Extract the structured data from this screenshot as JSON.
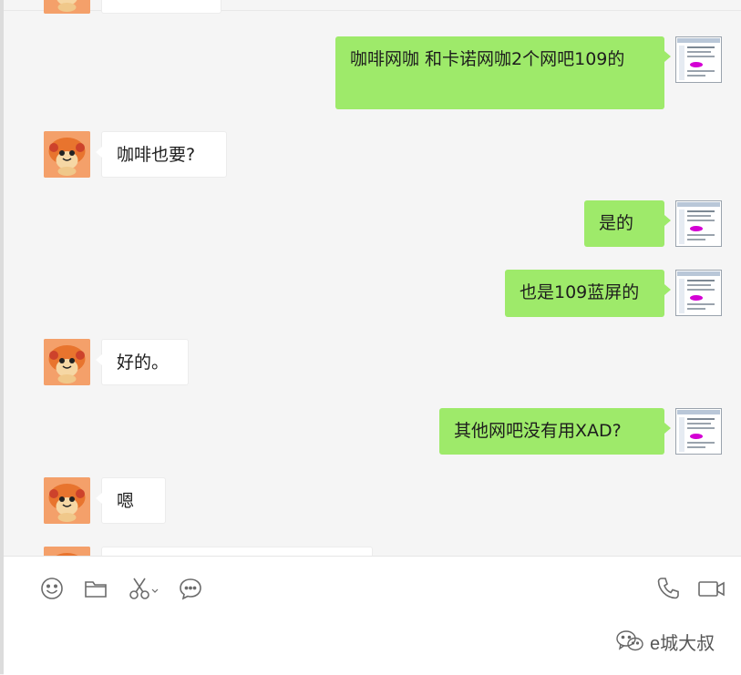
{
  "messages": [
    {
      "from": "me",
      "text": "咖啡网咖 和卡诺网咖2个网吧109的"
    },
    {
      "from": "friend",
      "text": "咖啡也要?"
    },
    {
      "from": "me",
      "text": "是的"
    },
    {
      "from": "me",
      "text": "也是109蓝屏的"
    },
    {
      "from": "friend",
      "text": "好的。"
    },
    {
      "from": "me",
      "text": "其他网吧没有用XAD?"
    },
    {
      "from": "friend",
      "text": "嗯"
    }
  ],
  "toolbar": {
    "icons": [
      "emoji-icon",
      "folder-icon",
      "scissors-icon",
      "chat-history-icon",
      "phone-icon",
      "video-call-icon"
    ]
  },
  "watermark": {
    "text": "e城大叔"
  },
  "colors": {
    "outgoing_bubble": "#9eea6a",
    "incoming_bubble": "#ffffff",
    "avatar_bg": "#f4a06a"
  }
}
